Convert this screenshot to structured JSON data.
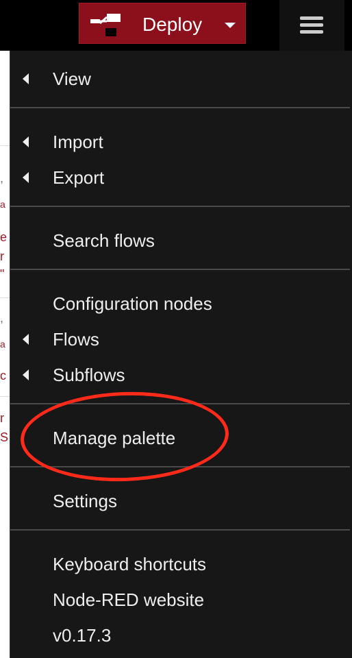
{
  "header": {
    "deploy_label": "Deploy",
    "deploy_icon": "deploy-icon",
    "menu_icon": "hamburger-icon",
    "accent_color": "#8c101c"
  },
  "workspace_fragments": [
    ",",
    "a",
    "e",
    "r",
    "\"",
    ",",
    "a",
    "c",
    "r",
    "S"
  ],
  "menu": {
    "items": [
      {
        "label": "View",
        "submenu": true
      },
      {
        "label": "Import",
        "submenu": true
      },
      {
        "label": "Export",
        "submenu": true
      },
      {
        "label": "Search flows",
        "submenu": false
      },
      {
        "label": "Configuration nodes",
        "submenu": false
      },
      {
        "label": "Flows",
        "submenu": true
      },
      {
        "label": "Subflows",
        "submenu": true
      },
      {
        "label": "Manage palette",
        "submenu": false
      },
      {
        "label": "Settings",
        "submenu": false
      },
      {
        "label": "Keyboard shortcuts",
        "submenu": false
      },
      {
        "label": "Node-RED website",
        "submenu": false
      },
      {
        "label": "v0.17.3",
        "submenu": false
      }
    ],
    "highlighted_item": "Manage palette",
    "highlight_color": "#ff2a1a"
  }
}
